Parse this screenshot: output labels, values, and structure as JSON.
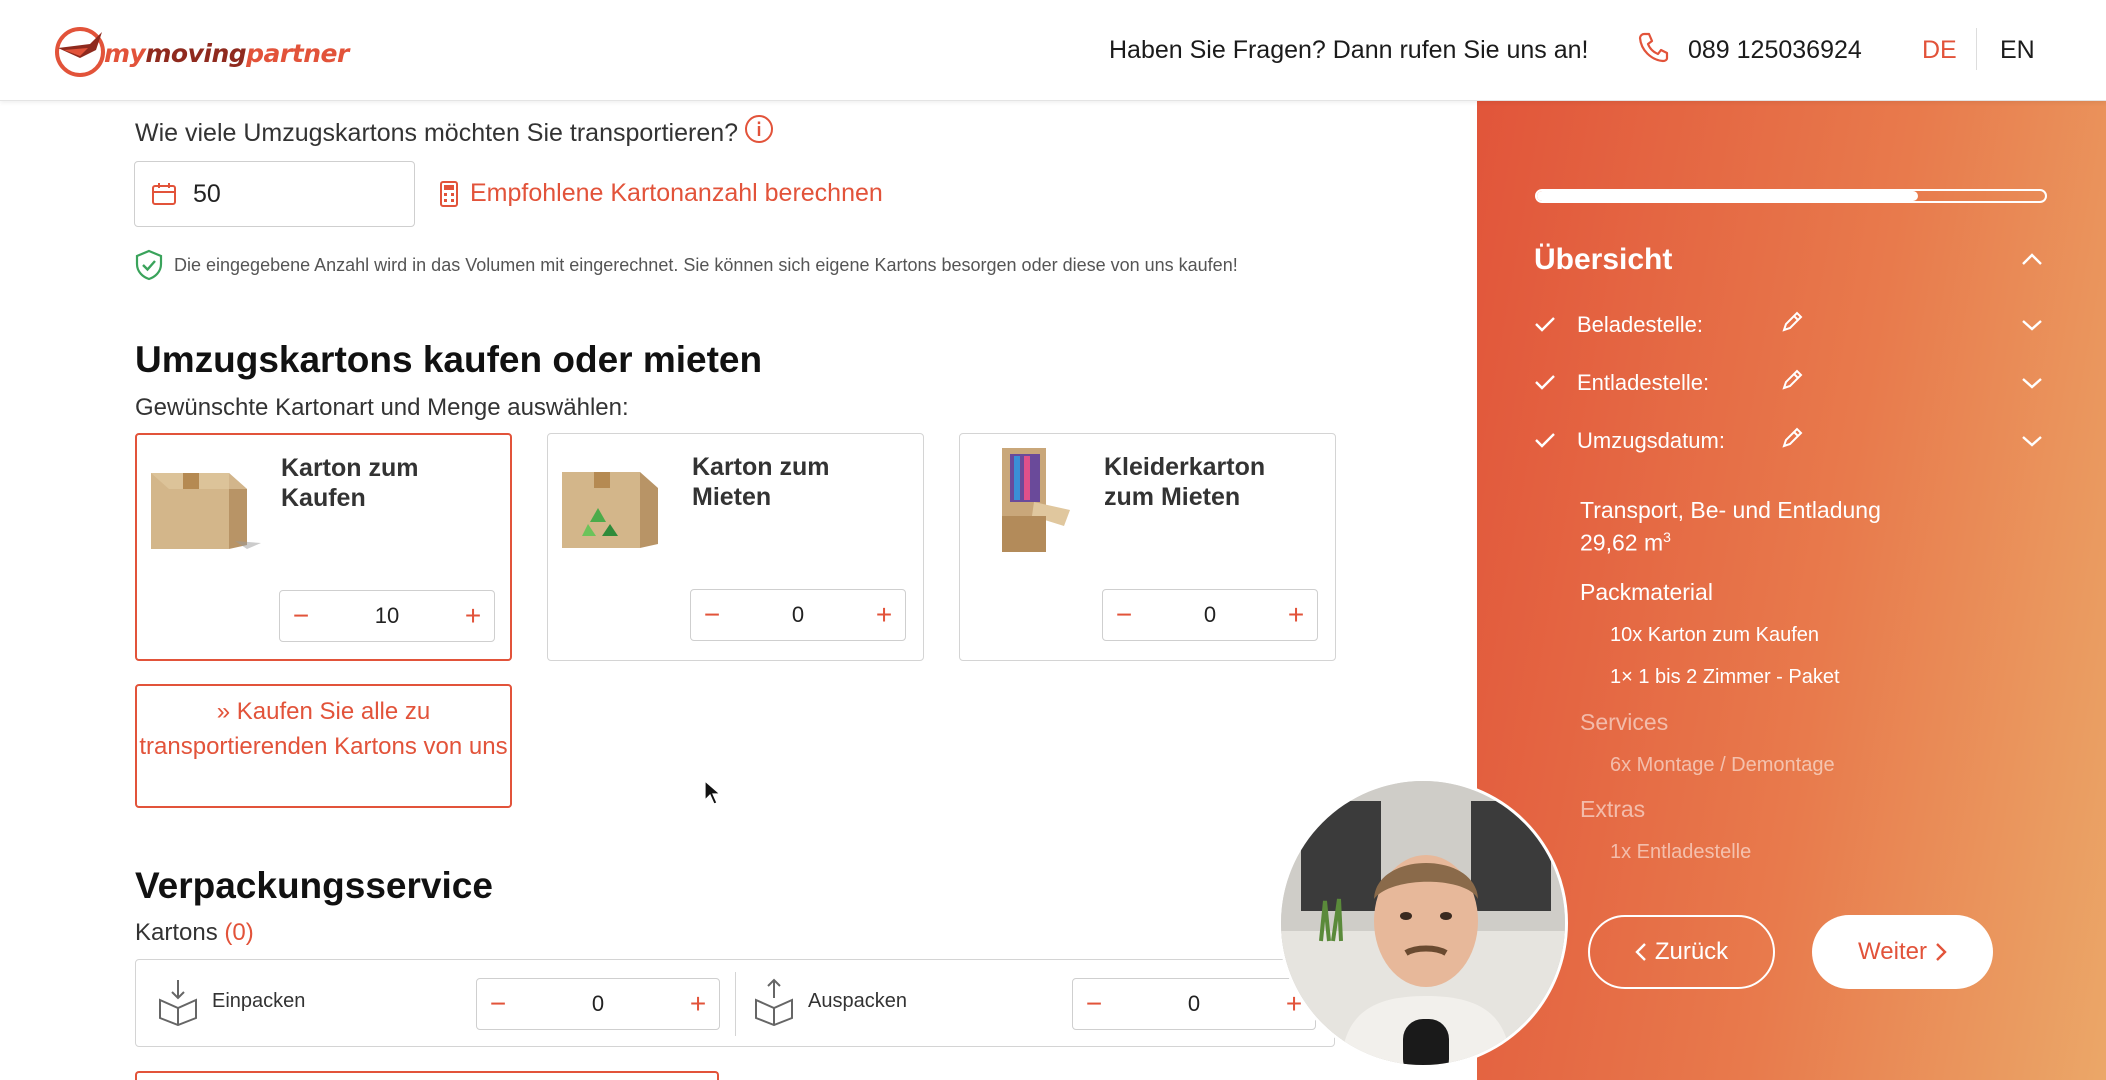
{
  "header": {
    "logo": {
      "my": "my",
      "moving": "moving",
      "partner": "partner"
    },
    "question": "Haben Sie Fragen? Dann rufen Sie uns an!",
    "phone": "089 125036924",
    "lang_de": "DE",
    "lang_en": "EN"
  },
  "boxes": {
    "question": "Wie viele Umzugskartons möchten Sie transportieren?",
    "quantity": "50",
    "calc_link": "Empfohlene Kartonanzahl berechnen",
    "hint": "Die eingegebene Anzahl wird in das Volumen mit eingerechnet. Sie können sich eigene Kartons besorgen oder diese von uns kaufen!"
  },
  "buy_section": {
    "title": "Umzugskartons kaufen oder mieten",
    "subtitle": "Gewünschte Kartonart und Menge auswählen:",
    "cards": [
      {
        "title": "Karton zum Kaufen",
        "qty": "10",
        "selected": true
      },
      {
        "title": "Karton zum Mieten",
        "qty": "0",
        "selected": false
      },
      {
        "title": "Kleiderkarton zum Mieten",
        "qty": "0",
        "selected": false
      }
    ],
    "minus": "−",
    "plus": "+",
    "buy_all": "Kaufen Sie alle zu transportierenden Kartons von uns"
  },
  "pack_section": {
    "title": "Verpackungsservice",
    "kartons_label": "Kartons",
    "kartons_count": "(0)",
    "pack_label": "Einpacken",
    "pack_qty": "0",
    "unpack_label": "Auspacken",
    "unpack_qty": "0"
  },
  "sidebar": {
    "progress": 0.75,
    "title": "Übersicht",
    "items": [
      {
        "label": "Beladestelle:"
      },
      {
        "label": "Entladestelle:"
      },
      {
        "label": "Umzugsdatum:"
      }
    ],
    "transport": "Transport, Be- und Entladung",
    "volume": "29,62 m",
    "volume_unit_sup": "3",
    "packmaterial": "Packmaterial",
    "pack_item_1": "10x Karton zum Kaufen",
    "pack_item_2": "1× 1 bis 2 Zimmer - Paket",
    "services": "Services",
    "service_item": "6x Montage / Demontage",
    "extras": "Extras",
    "extra_item": "1x Entladestelle",
    "back": "Zurück",
    "next": "Weiter"
  },
  "colors": {
    "accent": "#e2533a",
    "gradient_end": "#eba768"
  }
}
